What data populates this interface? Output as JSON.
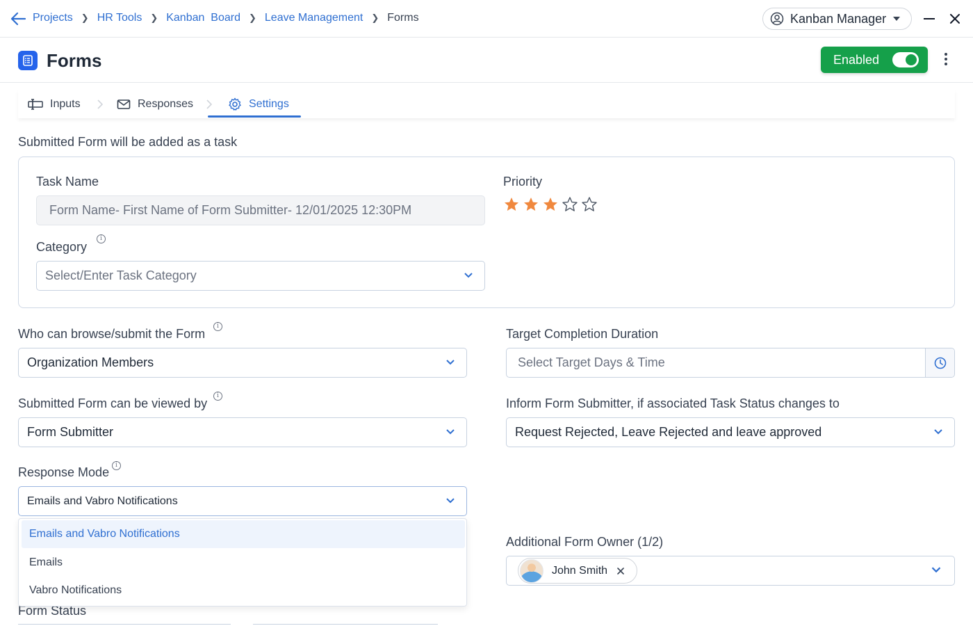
{
  "breadcrumb": {
    "items": [
      "Projects",
      "HR Tools",
      "Kanban  Board",
      "Leave Management"
    ],
    "current": "Forms"
  },
  "user_menu": {
    "label": "Kanban Manager",
    "icon": "user-circle-icon"
  },
  "header": {
    "title": "Forms",
    "enabled_label": "Enabled",
    "enabled_on": true
  },
  "tabs": [
    {
      "label": "Inputs",
      "icon": "input-icon",
      "active": false
    },
    {
      "label": "Responses",
      "icon": "mail-icon",
      "active": false
    },
    {
      "label": "Settings",
      "icon": "gear-icon",
      "active": true
    }
  ],
  "task_section": {
    "title": "Submitted Form will be added as a task",
    "task_name_label": "Task Name",
    "task_name_value": "Form Name- First Name of Form Submitter- 12/01/2025 12:30PM",
    "priority_label": "Priority",
    "priority_rating": 3,
    "priority_max": 5,
    "category_label": "Category",
    "category_placeholder": "Select/Enter Task Category"
  },
  "browse": {
    "label": "Who can browse/submit the Form",
    "value": "Organization Members"
  },
  "viewed_by": {
    "label": "Submitted Form can be viewed by",
    "value": "Form Submitter"
  },
  "response_mode": {
    "label": "Response Mode",
    "value": "Emails and Vabro Notifications",
    "options": [
      "Emails and Vabro Notifications",
      "Emails",
      "Vabro Notifications"
    ],
    "selected_index": 0
  },
  "target_duration": {
    "label": "Target Completion Duration",
    "placeholder": "Select Target Days & Time"
  },
  "inform_submitter": {
    "label": "Inform Form Submitter, if associated Task Status changes to",
    "value": "Request Rejected, Leave Rejected and leave approved"
  },
  "additional_owner": {
    "label": "Additional Form Owner (1/2)",
    "owner_name": "John Smith"
  },
  "form_status": {
    "label": "Form Status"
  },
  "colors": {
    "accent": "#2f6fd1",
    "enabled_green": "#15a04a",
    "star": "#f0883e"
  }
}
